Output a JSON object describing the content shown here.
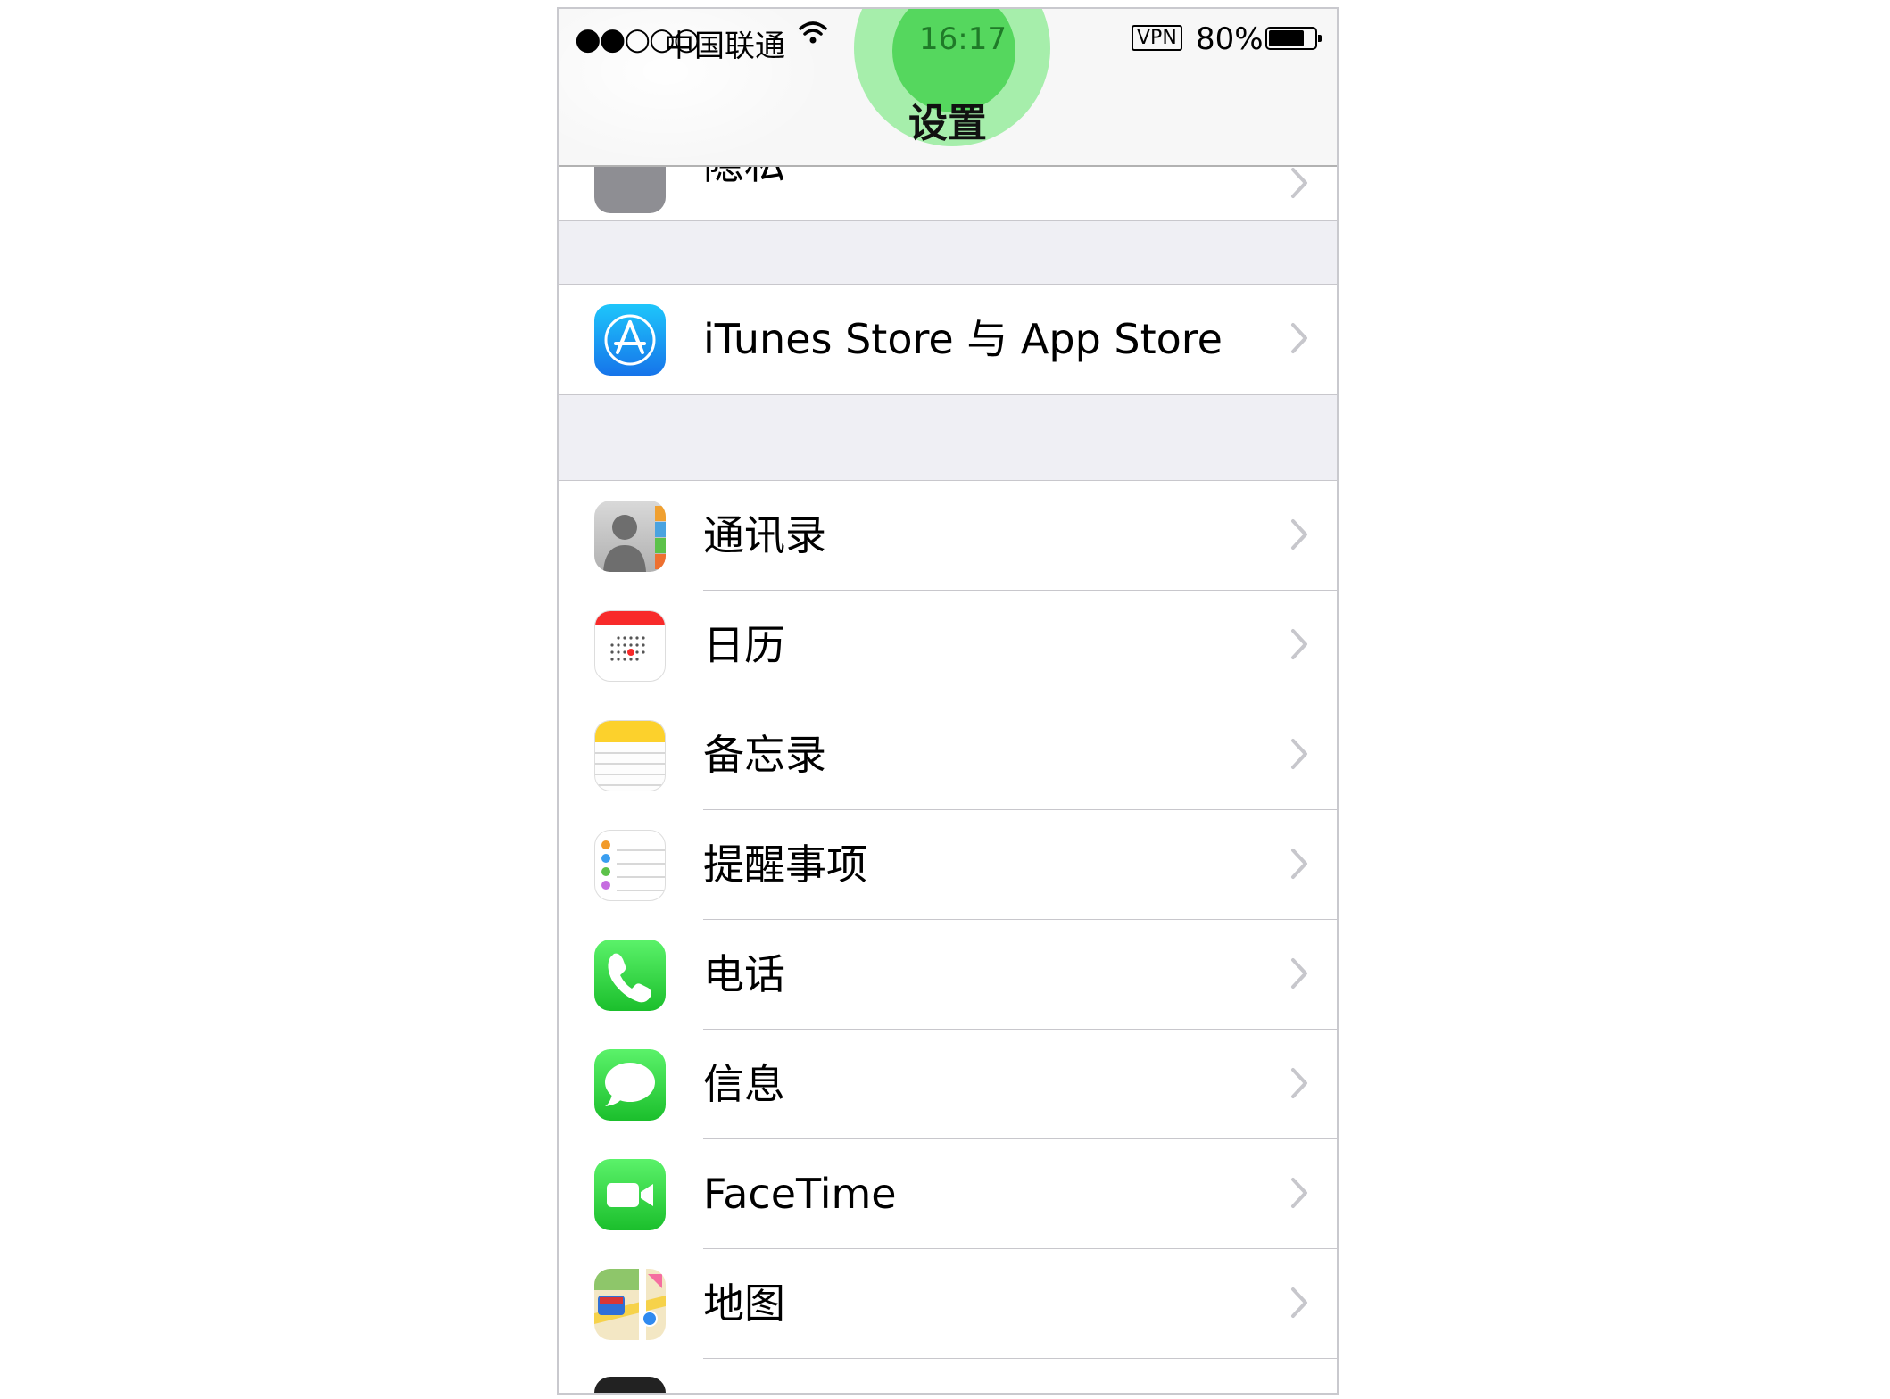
{
  "status_bar": {
    "signal": "●●○○○",
    "carrier": "中国联通",
    "time": "16:17",
    "vpn": "VPN",
    "battery": "80%",
    "battery_level": 0.8
  },
  "nav": {
    "title": "设置"
  },
  "colors": {
    "group_background": "#efeff4",
    "chevron": "#c7c7cc",
    "touch_indicator": "#46d250"
  },
  "partial_row": {
    "label": "隐私",
    "icon": "hand-icon"
  },
  "store_row": {
    "label": "iTunes Store 与 App Store",
    "icon": "app-store-icon"
  },
  "apps": [
    {
      "label": "通讯录",
      "icon": "contacts-icon"
    },
    {
      "label": "日历",
      "icon": "calendar-icon"
    },
    {
      "label": "备忘录",
      "icon": "notes-icon"
    },
    {
      "label": "提醒事项",
      "icon": "reminders-icon"
    },
    {
      "label": "电话",
      "icon": "phone-icon"
    },
    {
      "label": "信息",
      "icon": "messages-icon"
    },
    {
      "label": "FaceTime",
      "icon": "facetime-icon"
    },
    {
      "label": "地图",
      "icon": "maps-icon"
    }
  ]
}
